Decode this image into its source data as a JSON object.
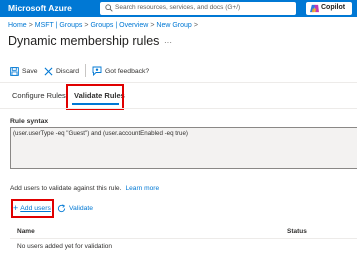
{
  "topbar": {
    "brand": "Microsoft Azure",
    "search_placeholder": "Search resources, services, and docs (G+/)",
    "copilot_label": "Copilot"
  },
  "breadcrumb": [
    "Home",
    "MSFT | Groups",
    "Groups | Overview",
    "New Group"
  ],
  "page": {
    "title": "Dynamic membership rules",
    "more": "···"
  },
  "toolbar": {
    "save": "Save",
    "discard": "Discard",
    "feedback": "Got feedback?"
  },
  "tabs": {
    "configure": "Configure Rules",
    "validate": "Validate Rules",
    "active": "validate"
  },
  "rule": {
    "label": "Rule syntax",
    "text": "(user.userType -eq \"Guest\") and (user.accountEnabled -eq true)"
  },
  "validate": {
    "helper": "Add users to validate against this rule.",
    "learn_more": "Learn more",
    "add_users": "Add users",
    "validate_label": "Validate"
  },
  "table": {
    "columns": [
      "Name",
      "Status"
    ],
    "empty_message": "No users added yet for validation"
  },
  "colors": {
    "accent": "#0078d4",
    "highlight": "#e00000"
  }
}
